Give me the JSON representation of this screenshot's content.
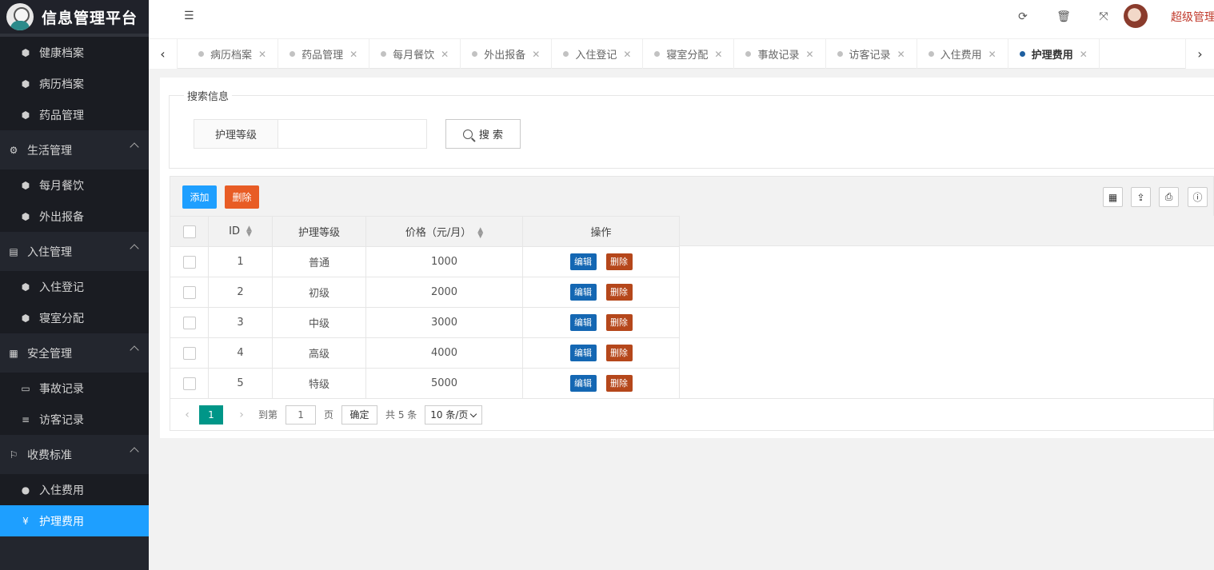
{
  "app": {
    "title": "信息管理平台",
    "user_name": "超级管理"
  },
  "sidebar": {
    "entries": [
      {
        "kind": "item",
        "label": "健康档案",
        "icon": "dashboard-icon",
        "glyph": "⬢"
      },
      {
        "kind": "item",
        "label": "病历档案",
        "icon": "dashboard-icon",
        "glyph": "⬢"
      },
      {
        "kind": "item",
        "label": "药品管理",
        "icon": "dashboard-icon",
        "glyph": "⬢"
      },
      {
        "kind": "group",
        "label": "生活管理",
        "icon": "gears-icon",
        "glyph": "⚙"
      },
      {
        "kind": "item",
        "label": "每月餐饮",
        "icon": "dashboard-icon",
        "glyph": "⬢"
      },
      {
        "kind": "item",
        "label": "外出报备",
        "icon": "dashboard-icon",
        "glyph": "⬢"
      },
      {
        "kind": "group",
        "label": "入住管理",
        "icon": "file-icon",
        "glyph": "▤"
      },
      {
        "kind": "item",
        "label": "入住登记",
        "icon": "dashboard-icon",
        "glyph": "⬢"
      },
      {
        "kind": "item",
        "label": "寝室分配",
        "icon": "dashboard-icon",
        "glyph": "⬢"
      },
      {
        "kind": "group",
        "label": "安全管理",
        "icon": "calendar-icon",
        "glyph": "▦"
      },
      {
        "kind": "item",
        "label": "事故记录",
        "icon": "list-alt-icon",
        "glyph": "▭"
      },
      {
        "kind": "item",
        "label": "访客记录",
        "icon": "bars-icon",
        "glyph": "≡"
      },
      {
        "kind": "group",
        "label": "收费标准",
        "icon": "flag-icon",
        "glyph": "⚐"
      },
      {
        "kind": "item",
        "label": "入住费用",
        "icon": "circle-icon",
        "glyph": "●"
      },
      {
        "kind": "item",
        "label": "护理费用",
        "icon": "yen-icon",
        "glyph": "¥",
        "active": true
      }
    ]
  },
  "header": {
    "icons": [
      {
        "name": "refresh-icon",
        "glyph": "⟳"
      },
      {
        "name": "trash-icon",
        "glyph": "🗑"
      },
      {
        "name": "fullscreen-icon",
        "glyph": "⤧"
      }
    ]
  },
  "tabs": [
    {
      "label": "病历档案"
    },
    {
      "label": "药品管理"
    },
    {
      "label": "每月餐饮"
    },
    {
      "label": "外出报备"
    },
    {
      "label": "入住登记"
    },
    {
      "label": "寝室分配"
    },
    {
      "label": "事故记录"
    },
    {
      "label": "访客记录"
    },
    {
      "label": "入住费用"
    },
    {
      "label": "护理费用",
      "active": true
    }
  ],
  "search": {
    "legend": "搜索信息",
    "field_label": "护理等级",
    "field_value": "",
    "button_label": "搜 索"
  },
  "toolbar": {
    "add_label": "添加",
    "delete_label": "删除",
    "tools": [
      {
        "name": "columns-filter-icon",
        "glyph": "▦"
      },
      {
        "name": "export-icon",
        "glyph": "⇪"
      },
      {
        "name": "print-icon",
        "glyph": "⎙"
      },
      {
        "name": "info-icon",
        "glyph": "ⓘ"
      }
    ]
  },
  "table": {
    "columns": {
      "id": "ID",
      "level": "护理等级",
      "price": "价格（元/月）",
      "action": "操作"
    },
    "edit_label": "编辑",
    "delete_label": "删除",
    "rows": [
      {
        "id": "1",
        "level": "普通",
        "price": "1000"
      },
      {
        "id": "2",
        "level": "初级",
        "price": "2000"
      },
      {
        "id": "3",
        "level": "中级",
        "price": "3000"
      },
      {
        "id": "4",
        "level": "高级",
        "price": "4000"
      },
      {
        "id": "5",
        "level": "特级",
        "price": "5000"
      }
    ]
  },
  "pager": {
    "current_page": "1",
    "goto_prefix": "到第",
    "goto_value": "1",
    "goto_suffix": "页",
    "confirm_label": "确定",
    "total_text": "共 5 条",
    "page_size": "10 条/页"
  }
}
